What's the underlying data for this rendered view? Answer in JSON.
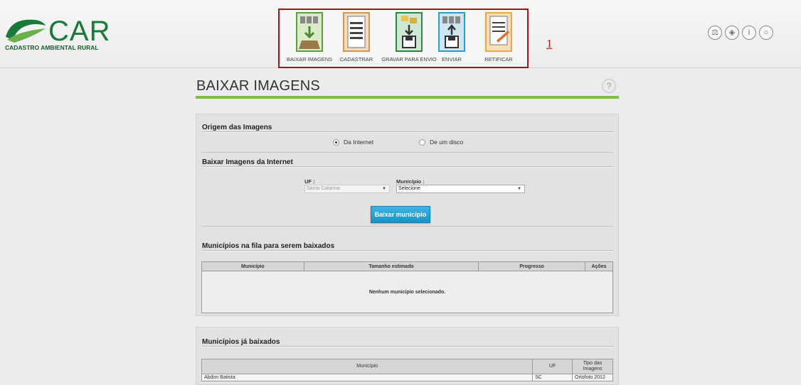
{
  "app": {
    "logo_title": "CAR",
    "logo_subtitle": "CADASTRO AMBIENTAL RURAL",
    "brand_color": "#1a7a3c"
  },
  "toolbar": {
    "annotation_number": "1",
    "items": [
      {
        "label": "BAIXAR IMAGENS",
        "icon": "download-images-icon",
        "color": "#5aa03c"
      },
      {
        "label": "CADASTRAR",
        "icon": "register-document-icon",
        "color": "#d9974a"
      },
      {
        "label": "GRAVAR PARA ENVIO",
        "icon": "save-for-sending-icon",
        "color": "#2a8a44"
      },
      {
        "label": "ENVIAR",
        "icon": "send-upload-icon",
        "color": "#2f9ad3"
      },
      {
        "label": "RETIFICAR",
        "icon": "rectify-document-icon",
        "color": "#f0a64c"
      }
    ]
  },
  "header_icons": [
    {
      "name": "scales-icon",
      "glyph": "⚖"
    },
    {
      "name": "book-icon",
      "glyph": "◈"
    },
    {
      "name": "info-icon",
      "glyph": "i"
    },
    {
      "name": "power-icon",
      "glyph": "○"
    }
  ],
  "page": {
    "title": "BAIXAR IMAGENS",
    "help_glyph": "?",
    "accent_color": "#7dc23f"
  },
  "origin": {
    "heading": "Origem das Imagens",
    "options": [
      {
        "label": "Da Internet",
        "selected": true
      },
      {
        "label": "De um disco",
        "selected": false
      }
    ]
  },
  "download": {
    "heading": "Baixar Imagens da Internet",
    "uf_label": "UF :",
    "uf_value": "Santa Catarina",
    "municipio_label": "Município :",
    "municipio_value": "Selecione",
    "button_label": "Baixar município"
  },
  "queue": {
    "heading": "Municípios na fila para serem baixados",
    "columns": [
      "Município",
      "Tamanho estimado",
      "Progresso",
      "Ações"
    ],
    "empty_text": "Nenhum município selecionado."
  },
  "downloaded": {
    "heading": "Municípios já baixados",
    "columns": [
      "Município",
      "UF",
      "Tipo das Imagens"
    ],
    "rows": [
      {
        "municipio": "Abdon Batista",
        "uf": "SC",
        "tipo": "Ortofoto 2012"
      }
    ]
  }
}
